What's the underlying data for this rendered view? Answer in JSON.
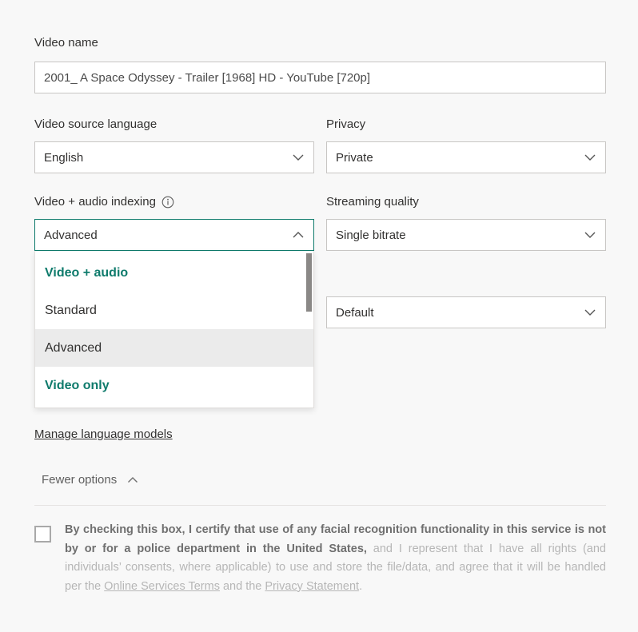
{
  "form": {
    "video_name": {
      "label": "Video name",
      "value": "2001_ A Space Odyssey - Trailer [1968] HD - YouTube [720p]"
    },
    "source_language": {
      "label": "Video source language",
      "value": "English"
    },
    "privacy": {
      "label": "Privacy",
      "value": "Private"
    },
    "indexing": {
      "label": "Video + audio indexing",
      "value": "Advanced",
      "info_icon": "info-circle-icon",
      "expanded": true,
      "options": [
        {
          "label": "Video + audio",
          "type": "header",
          "selected": false
        },
        {
          "label": "Standard",
          "type": "item",
          "selected": false
        },
        {
          "label": "Advanced",
          "type": "item",
          "selected": true
        },
        {
          "label": "Video only",
          "type": "header",
          "selected": false
        }
      ]
    },
    "streaming_quality": {
      "label": "Streaming quality",
      "value": "Single bitrate"
    },
    "default_select": {
      "value": "Default"
    },
    "manage_language_models": "Manage language models",
    "fewer_options": "Fewer options"
  },
  "consent": {
    "bold_part": "By checking this box, I certify that use of any facial recognition functionality in this service is not by or for a police department in the United States,",
    "rest_1": " and I represent that I have all rights (and individuals’ consents, where applicable) to use and store the file/data, and agree that it will be handled per the ",
    "link_1": "Online Services Terms",
    "mid": " and the ",
    "link_2": "Privacy Statement",
    "end": "."
  },
  "colors": {
    "accent_teal": "#0f7b6c",
    "page_background": "#f8f8f8",
    "input_background": "#ffffff",
    "border": "#c8c6c4",
    "selected_option": "#ebebeb"
  },
  "icons": {
    "chevron_down": "chevron-down-icon",
    "chevron_up": "chevron-up-icon",
    "info": "info-circle-icon",
    "checkbox": "checkbox-unchecked-icon"
  }
}
